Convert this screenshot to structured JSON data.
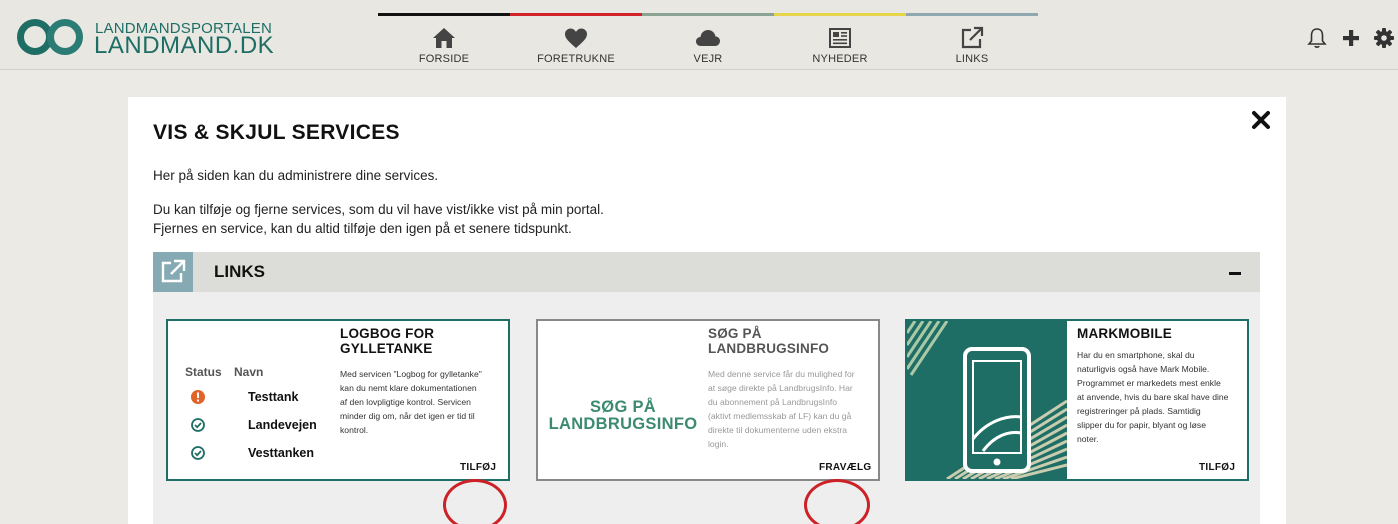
{
  "header": {
    "logo_line1": "LANDMANDSPORTALEN",
    "logo_line2": "LANDMAND.DK",
    "nav": [
      {
        "label": "FORSIDE",
        "icon": "home-icon"
      },
      {
        "label": "FORETRUKNE",
        "icon": "heart-icon"
      },
      {
        "label": "VEJR",
        "icon": "cloud-icon"
      },
      {
        "label": "NYHEDER",
        "icon": "newspaper-icon"
      },
      {
        "label": "LINKS",
        "icon": "external-link-icon"
      }
    ],
    "stripe_colors": [
      "#111111",
      "#d2232a",
      "#8aa393",
      "#e6d548",
      "#8fa7ae"
    ],
    "tools": [
      "bell-icon",
      "plus-icon",
      "gear-icon"
    ]
  },
  "modal": {
    "title": "VIS & SKJUL SERVICES",
    "intro": "Her på siden kan du administrere dine services.",
    "text1": "Du kan tilføje og fjerne services, som du vil have vist/ikke vist på min portal.",
    "text2": "Fjernes en service, kan du altid tilføje den igen på et senere tidspunkt.",
    "section": {
      "title": "LINKS",
      "cards": [
        {
          "title_line1": "LOGBOG FOR",
          "title_line2": "GYLLETANKE",
          "text": [
            "Med servicen \"Logbog for gylletanke\"",
            "kan du nemt klare dokumentationen",
            "af den lovpligtige kontrol. Servicen",
            "minder dig om, når det igen er tid til",
            "kontrol."
          ],
          "button": "TILFØJ",
          "table": {
            "col_status": "Status",
            "col_name": "Navn",
            "rows": [
              {
                "name": "Testtank",
                "status": "warning"
              },
              {
                "name": "Landevejen",
                "status": "ok"
              },
              {
                "name": "Vesttanken",
                "status": "ok"
              }
            ]
          }
        },
        {
          "title_line1": "SØG PÅ",
          "title_line2": "LANDBRUGSINFO",
          "image_line1": "SØG PÅ",
          "image_line2": "LANDBRUGSINFO",
          "text": [
            "Med denne service får du mulighed for",
            "at søge direkte på LandbrugsInfo. Har",
            "du abonnement på LandbrugsInfo",
            "(aktivt medlemsskab af LF) kan du gå",
            "direkte til dokumenterne uden ekstra",
            "login."
          ],
          "button": "FRAVÆLG"
        },
        {
          "title": "MARKMOBILE",
          "text": [
            "Har du en smartphone, skal du",
            "naturligvis også have Mark Mobile.",
            "Programmet er markedets mest enkle",
            "at anvende, hvis du bare skal have dine",
            "registreringer på plads. Samtidig",
            "slipper du for papir, blyant og løse",
            "noter."
          ],
          "button": "TILFØJ"
        }
      ]
    }
  },
  "colors": {
    "brand": "#1f6e66",
    "highlight_circle": "#cc2127",
    "warning": "#e0632a",
    "section_icon_bg": "#86aab4"
  }
}
